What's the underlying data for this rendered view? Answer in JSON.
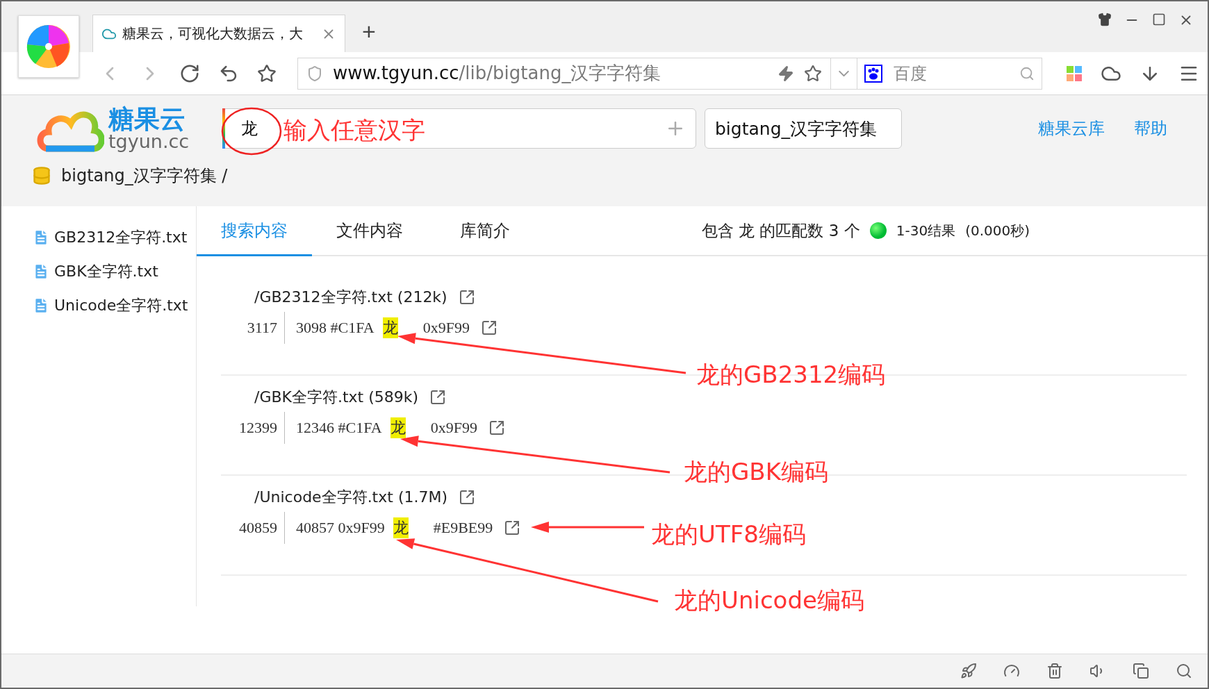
{
  "browser": {
    "tab": {
      "title": "糖果云，可视化大数据云，大",
      "selected": true
    },
    "new_tab": "+",
    "url": {
      "host": "www.tgyun.cc",
      "path": "/lib/bigtang_汉字字符集"
    },
    "search_engine": {
      "placeholder": "百度"
    }
  },
  "site": {
    "logo": {
      "name": "糖果云",
      "domain": "tgyun.cc"
    },
    "search": {
      "value": "龙"
    },
    "library_field": {
      "value": "bigtang_汉字字符集"
    },
    "links": [
      "糖果云库",
      "帮助"
    ],
    "breadcrumb": "bigtang_汉字字符集 /"
  },
  "sidebar": {
    "files": [
      "GB2312全字符.txt",
      "GBK全字符.txt",
      "Unicode全字符.txt"
    ]
  },
  "tabs": [
    {
      "label": "搜索内容",
      "selected": true
    },
    {
      "label": "文件内容",
      "selected": false
    },
    {
      "label": "库简介",
      "selected": false
    }
  ],
  "summary": {
    "matches": "包含 龙 的匹配数 3 个",
    "range": "1-30结果",
    "time": "(0.000秒)"
  },
  "results": [
    {
      "file": "/GB2312全字符.txt (212k)",
      "line_number": "3117",
      "index": "3098",
      "code": "#C1FA",
      "char": "龙",
      "alt_code": "0x9F99"
    },
    {
      "file": "/GBK全字符.txt (589k)",
      "line_number": "12399",
      "index": "12346",
      "code": "#C1FA",
      "char": "龙",
      "alt_code": "0x9F99"
    },
    {
      "file": "/Unicode全字符.txt (1.7M)",
      "line_number": "40859",
      "index": "40857",
      "code": "0x9F99",
      "char": "龙",
      "alt_code": "#E9BE99"
    }
  ],
  "annotations": {
    "input_hint": "输入任意汉字",
    "labels": [
      "龙的GB2312编码",
      "龙的GBK编码",
      "龙的UTF8编码",
      "龙的Unicode编码"
    ]
  }
}
